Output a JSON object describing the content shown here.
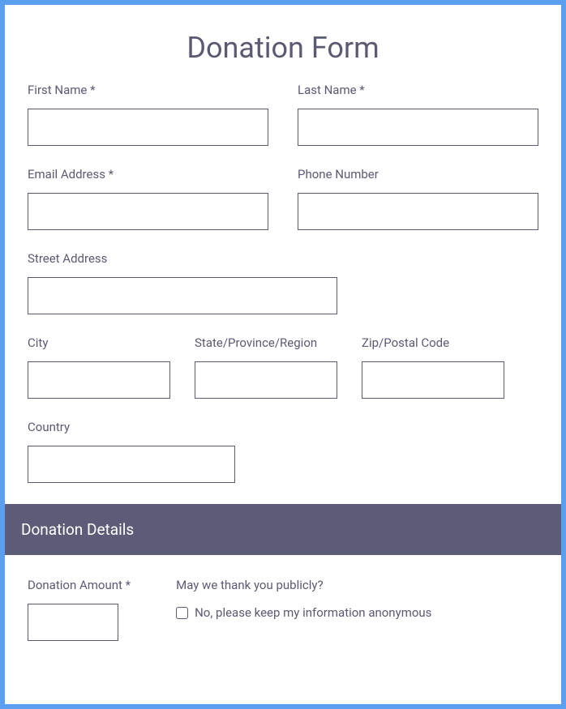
{
  "title": "Donation Form",
  "fields": {
    "first_name": "First Name *",
    "last_name": "Last Name *",
    "email": "Email Address *",
    "phone": "Phone Number",
    "street": "Street Address",
    "city": "City",
    "state": "State/Province/Region",
    "zip": "Zip/Postal Code",
    "country": "Country"
  },
  "section_header": "Donation Details",
  "details": {
    "amount_label": "Donation Amount *",
    "thank_label": "May we thank you publicly?",
    "anonymous_label": "No, please keep my information anonymous"
  }
}
